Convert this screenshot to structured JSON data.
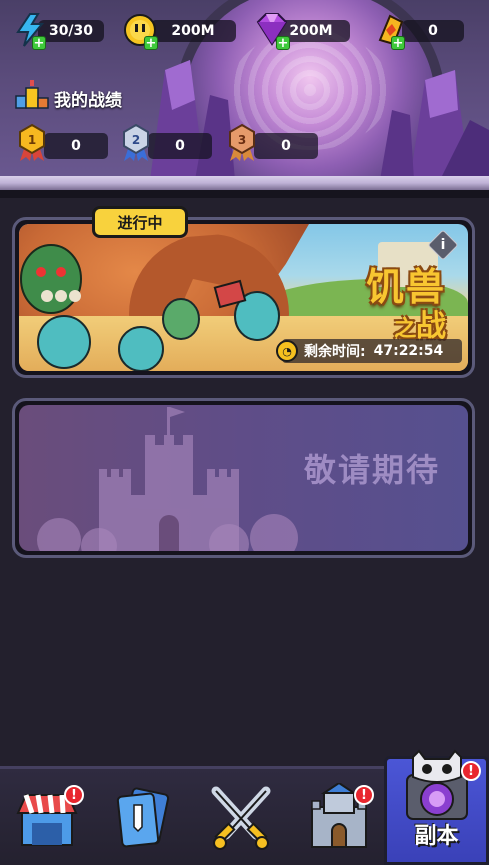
{
  "resources": {
    "energy": {
      "value": "30/30",
      "icon": "lightning-icon"
    },
    "coins": {
      "value": "200M",
      "icon": "coin-icon"
    },
    "gems": {
      "value": "200M",
      "icon": "gem-icon"
    },
    "tickets": {
      "value": "0",
      "icon": "ticket-icon"
    }
  },
  "record": {
    "title": "我的战绩",
    "medals": [
      {
        "rank": "1",
        "count": "0"
      },
      {
        "rank": "2",
        "count": "0"
      },
      {
        "rank": "3",
        "count": "0"
      }
    ]
  },
  "event": {
    "status_tag": "进行中",
    "title_line1": "饥兽",
    "title_small": "之",
    "title_line2": "战",
    "info_label": "i",
    "timer_label": "剩余时间:",
    "timer_value": "47:22:54"
  },
  "coming_soon": {
    "text": "敬请期待"
  },
  "nav": {
    "shop_badge": "!",
    "castle_badge": "!",
    "dungeon_badge": "!",
    "active_label": "副本"
  },
  "colors": {
    "background": "#23202d",
    "accent_yellow": "#f8d23d",
    "active_tab": "#4b56d6",
    "badge_red": "#e8262e"
  }
}
